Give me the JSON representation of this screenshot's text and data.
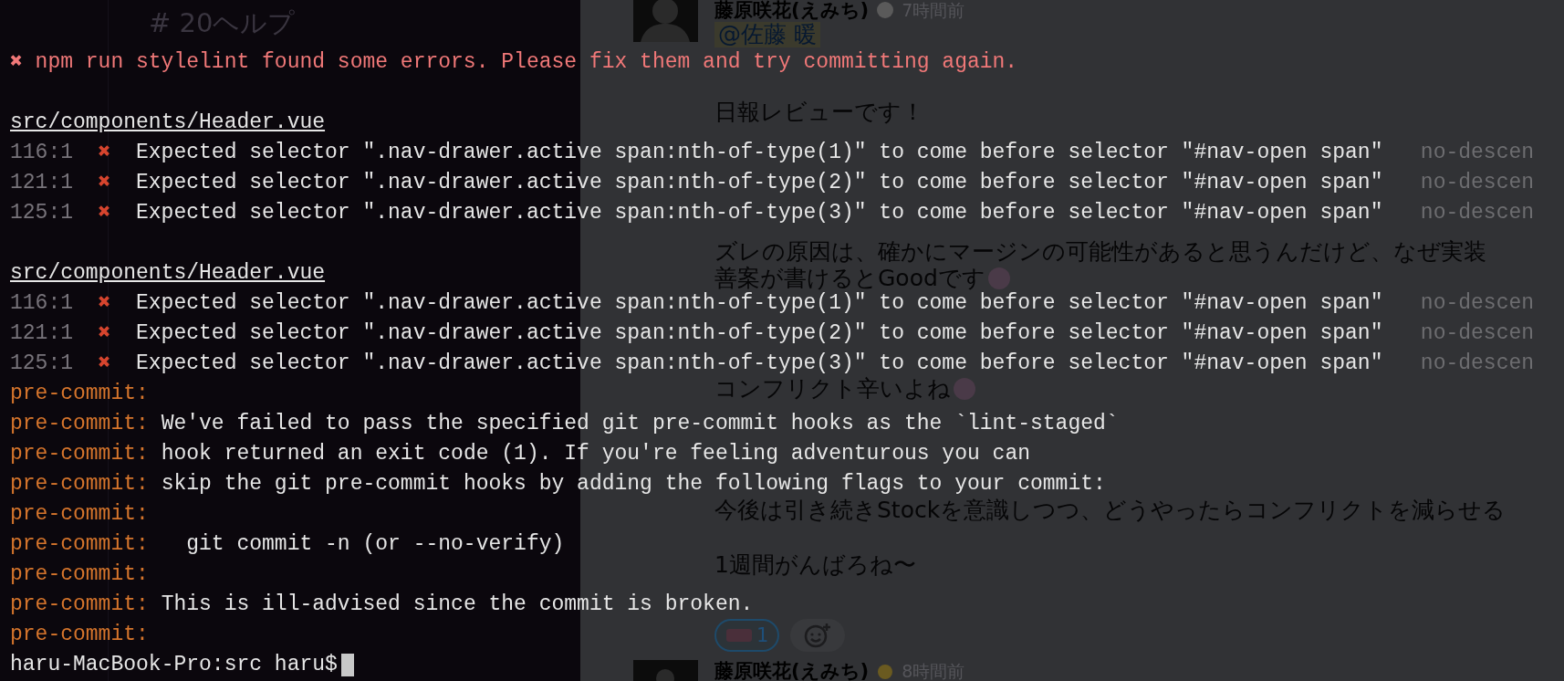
{
  "channels": [
    {
      "name": "# 20ヘルプ"
    }
  ],
  "message": {
    "author": "藤原咲花(えみち)",
    "time": "7時間前",
    "mention": "@佐藤 暖",
    "paragraphs": [
      [
        {
          "kind": "text",
          "text": "日報レビューです！"
        }
      ],
      [
        {
          "kind": "text",
          "text": "ズレの原因は、確かにマージンの可能性があると思うんだけど、なぜ実装"
        },
        {
          "kind": "text-emoji",
          "text": "善案が書けるとGoodです"
        }
      ],
      [
        {
          "kind": "text-emoji",
          "text": "コンフリクト辛いよね"
        }
      ],
      [
        {
          "kind": "text",
          "text": "今後は引き続きStockを意識しつつ、どうやったらコンフリクトを減らせる"
        }
      ],
      [
        {
          "kind": "text",
          "text": "1週間がんばろね〜"
        }
      ]
    ],
    "reactions": [
      {
        "count": "1"
      }
    ]
  },
  "next_message": {
    "author": "藤原咲花(えみち)",
    "time": "8時間前"
  },
  "terminal": {
    "summary_mark": "✖",
    "summary": "npm run stylelint found some errors. Please fix them and try committing again.",
    "files": [
      {
        "path": "src/components/Header.vue",
        "problems": [
          {
            "location": "116:1",
            "mark": "✖",
            "message": "Expected selector \".nav-drawer.active span:nth-of-type(1)\" to come before selector \"#nav-open span\"",
            "rule": "no-descen"
          },
          {
            "location": "121:1",
            "mark": "✖",
            "message": "Expected selector \".nav-drawer.active span:nth-of-type(2)\" to come before selector \"#nav-open span\"",
            "rule": "no-descen"
          },
          {
            "location": "125:1",
            "mark": "✖",
            "message": "Expected selector \".nav-drawer.active span:nth-of-type(3)\" to come before selector \"#nav-open span\"",
            "rule": "no-descen"
          }
        ]
      },
      {
        "path": "src/components/Header.vue",
        "problems": [
          {
            "location": "116:1",
            "mark": "✖",
            "message": "Expected selector \".nav-drawer.active span:nth-of-type(1)\" to come before selector \"#nav-open span\"",
            "rule": "no-descen"
          },
          {
            "location": "121:1",
            "mark": "✖",
            "message": "Expected selector \".nav-drawer.active span:nth-of-type(2)\" to come before selector \"#nav-open span\"",
            "rule": "no-descen"
          },
          {
            "location": "125:1",
            "mark": "✖",
            "message": "Expected selector \".nav-drawer.active span:nth-of-type(3)\" to come before selector \"#nav-open span\"",
            "rule": "no-descen"
          }
        ]
      }
    ],
    "hook_lines": [
      {
        "kind": "empty",
        "prefix": "pre-commit:"
      },
      {
        "kind": "message",
        "prefix": "pre-commit:",
        "text": "We've failed to pass the specified git pre-commit hooks as the `lint-staged`"
      },
      {
        "kind": "message",
        "prefix": "pre-commit:",
        "text": "hook returned an exit code (1). If you're feeling adventurous you can"
      },
      {
        "kind": "message",
        "prefix": "pre-commit:",
        "text": "skip the git pre-commit hooks by adding the following flags to your commit:"
      },
      {
        "kind": "empty",
        "prefix": "pre-commit:"
      },
      {
        "kind": "command",
        "prefix": "pre-commit:",
        "text": "git commit -n (or --no-verify)"
      },
      {
        "kind": "empty",
        "prefix": "pre-commit:"
      },
      {
        "kind": "message",
        "prefix": "pre-commit:",
        "text": "This is ill-advised since the commit is broken."
      },
      {
        "kind": "empty",
        "prefix": "pre-commit:"
      }
    ],
    "prompt": "haru-MacBook-Pro:src haru$"
  }
}
